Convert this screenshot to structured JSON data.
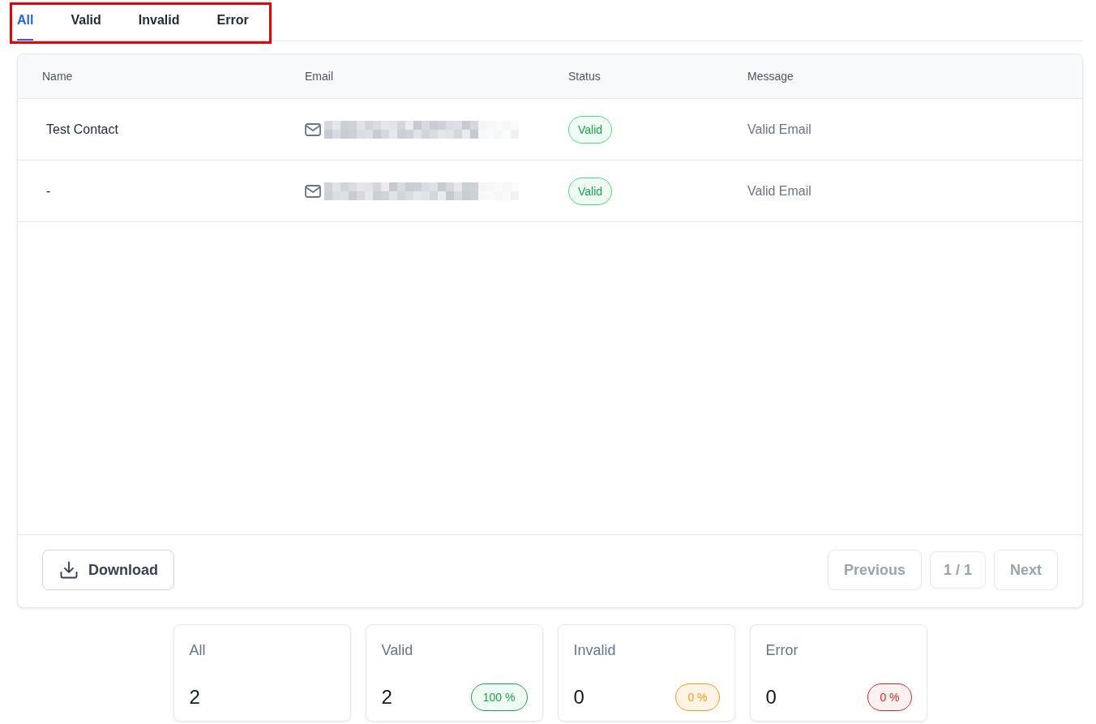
{
  "tabs_highlighted": true,
  "tabs": [
    {
      "label": "All",
      "selected": true
    },
    {
      "label": "Valid",
      "selected": false
    },
    {
      "label": "Invalid",
      "selected": false
    },
    {
      "label": "Error",
      "selected": false
    }
  ],
  "table": {
    "columns": [
      "Name",
      "Email",
      "Status",
      "Message"
    ],
    "rows": [
      {
        "name": "Test Contact",
        "email_redacted": true,
        "status": {
          "label": "Valid",
          "kind": "valid"
        },
        "message": "Valid Email"
      },
      {
        "name": "-",
        "email_redacted": true,
        "status": {
          "label": "Valid",
          "kind": "valid"
        },
        "message": "Valid Email"
      }
    ]
  },
  "footer": {
    "download_button": "Download",
    "pagination": {
      "previous": {
        "label": "Previous",
        "disabled": true
      },
      "page": "1 / 1",
      "next": {
        "label": "Next",
        "disabled": true
      }
    }
  },
  "stats": [
    {
      "label": "All",
      "count": "2"
    },
    {
      "label": "Valid",
      "count": "2",
      "percent": "100 %",
      "kind": "valid"
    },
    {
      "label": "Invalid",
      "count": "0",
      "percent": "0 %",
      "kind": "invalid"
    },
    {
      "label": "Error",
      "count": "0",
      "percent": "0 %",
      "kind": "error"
    }
  ]
}
